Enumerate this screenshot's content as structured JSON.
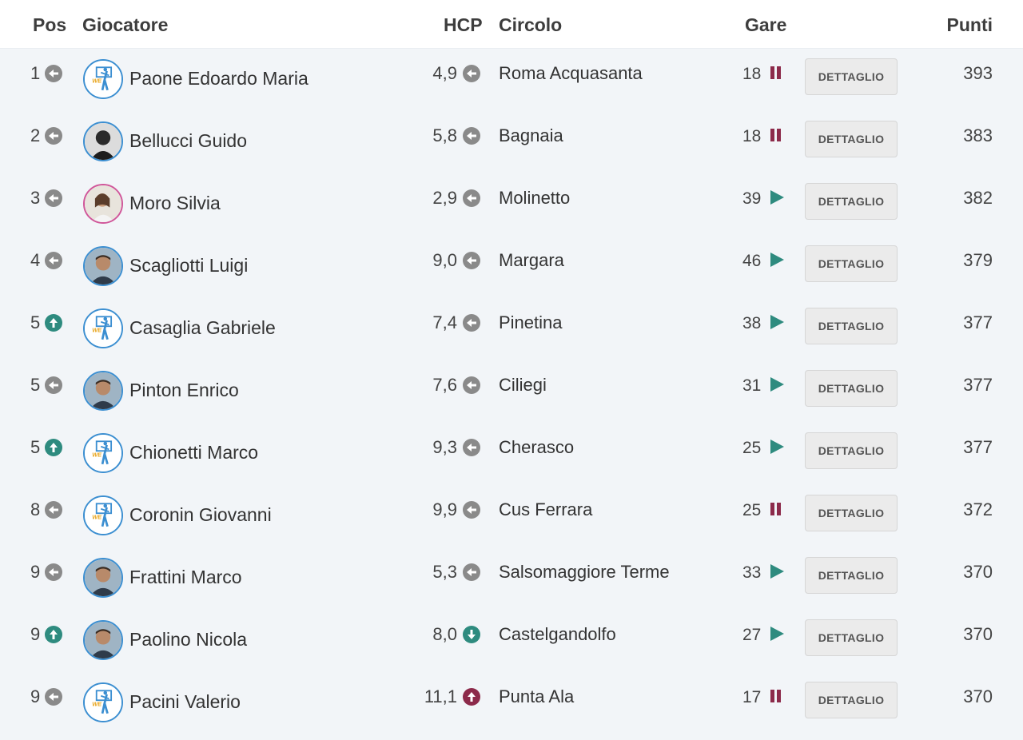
{
  "headers": {
    "pos": "Pos",
    "player": "Giocatore",
    "hcp": "HCP",
    "circle": "Circolo",
    "gare": "Gare",
    "punti": "Punti"
  },
  "button_label": "DETTAGLIO",
  "colors": {
    "neutral": "#8a8a8a",
    "up": "#2e8b7f",
    "down": "#2e8b7f",
    "up_bad": "#8c2a4a",
    "pause": "#8c2a4a",
    "play": "#2e8b7f"
  },
  "rows": [
    {
      "pos": "1",
      "pos_trend": "neutral",
      "player": "Paone Edoardo Maria",
      "avatar": "wegolfers-logo",
      "hcp": "4,9",
      "hcp_trend": "neutral",
      "circle": "Roma Acquasanta",
      "gare": "18",
      "gare_status": "pause",
      "punti": "393"
    },
    {
      "pos": "2",
      "pos_trend": "neutral",
      "player": "Bellucci Guido",
      "avatar": "photo-dark",
      "hcp": "5,8",
      "hcp_trend": "neutral",
      "circle": "Bagnaia",
      "gare": "18",
      "gare_status": "pause",
      "punti": "383"
    },
    {
      "pos": "3",
      "pos_trend": "neutral",
      "player": "Moro Silvia",
      "avatar": "photo-female",
      "hcp": "2,9",
      "hcp_trend": "neutral",
      "circle": "Molinetto",
      "gare": "39",
      "gare_status": "play",
      "punti": "382"
    },
    {
      "pos": "4",
      "pos_trend": "neutral",
      "player": "Scagliotti Luigi",
      "avatar": "photo",
      "hcp": "9,0",
      "hcp_trend": "neutral",
      "circle": "Margara",
      "gare": "46",
      "gare_status": "play",
      "punti": "379"
    },
    {
      "pos": "5",
      "pos_trend": "up",
      "player": "Casaglia Gabriele",
      "avatar": "wegolfers-logo",
      "hcp": "7,4",
      "hcp_trend": "neutral",
      "circle": "Pinetina",
      "gare": "38",
      "gare_status": "play",
      "punti": "377"
    },
    {
      "pos": "5",
      "pos_trend": "neutral",
      "player": "Pinton Enrico",
      "avatar": "photo",
      "hcp": "7,6",
      "hcp_trend": "neutral",
      "circle": "Ciliegi",
      "gare": "31",
      "gare_status": "play",
      "punti": "377"
    },
    {
      "pos": "5",
      "pos_trend": "up",
      "player": "Chionetti Marco",
      "avatar": "wegolfers-logo",
      "hcp": "9,3",
      "hcp_trend": "neutral",
      "circle": "Cherasco",
      "gare": "25",
      "gare_status": "play",
      "punti": "377"
    },
    {
      "pos": "8",
      "pos_trend": "neutral",
      "player": "Coronin Giovanni",
      "avatar": "wegolfers-logo",
      "hcp": "9,9",
      "hcp_trend": "neutral",
      "circle": "Cus Ferrara",
      "gare": "25",
      "gare_status": "pause",
      "punti": "372"
    },
    {
      "pos": "9",
      "pos_trend": "neutral",
      "player": "Frattini Marco",
      "avatar": "photo",
      "hcp": "5,3",
      "hcp_trend": "neutral",
      "circle": "Salsomaggiore Terme",
      "gare": "33",
      "gare_status": "play",
      "punti": "370"
    },
    {
      "pos": "9",
      "pos_trend": "up",
      "player": "Paolino Nicola",
      "avatar": "photo",
      "hcp": "8,0",
      "hcp_trend": "down",
      "circle": "Castelgandolfo",
      "gare": "27",
      "gare_status": "play",
      "punti": "370"
    },
    {
      "pos": "9",
      "pos_trend": "neutral",
      "player": "Pacini Valerio",
      "avatar": "wegolfers-logo",
      "hcp": "11,1",
      "hcp_trend": "up_bad",
      "circle": "Punta Ala",
      "gare": "17",
      "gare_status": "pause",
      "punti": "370"
    }
  ]
}
